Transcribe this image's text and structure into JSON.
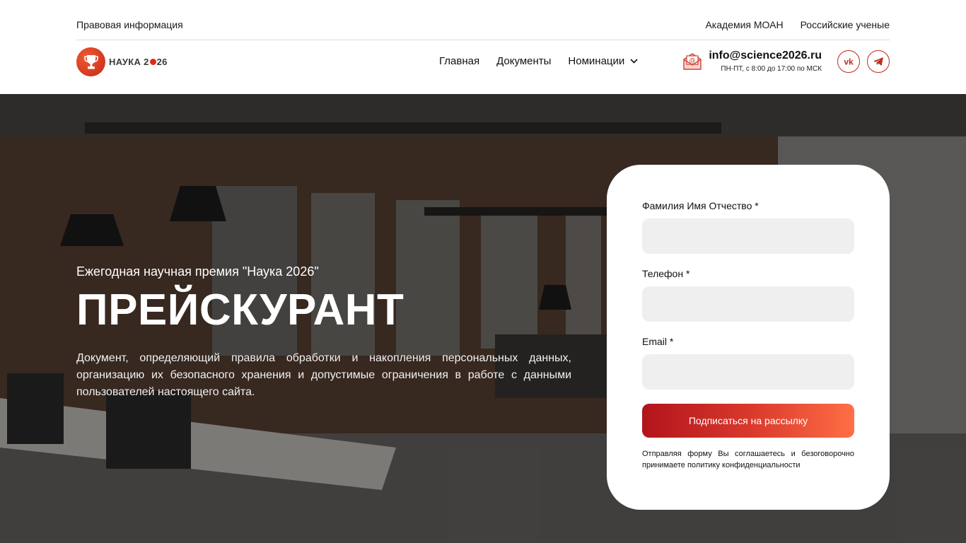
{
  "topbar": {
    "legal": "Правовая информация",
    "links": [
      "Академия МОАН",
      "Российские ученые"
    ]
  },
  "header": {
    "logo": {
      "prefix": "НАУКА 2",
      "suffix": "26"
    },
    "nav": [
      "Главная",
      "Документы",
      "Номинации"
    ],
    "contact": {
      "email": "info@science2026.ru",
      "hours": "ПН-ПТ, с 8:00 до 17:00 по МСК"
    },
    "socials": [
      "vk-icon",
      "telegram-icon"
    ]
  },
  "hero": {
    "subtitle": "Ежегодная научная премия \"Наука 2026\"",
    "title": "ПРЕЙСКУРАНТ",
    "description": "Документ, определяющий правила обработки и накопления персональных данных, организацию их безопасного хранения и допустимые ограничения в работе с данными пользователей настоящего сайта."
  },
  "form": {
    "fields": [
      {
        "label": "Фамилия Имя Отчество *",
        "value": "",
        "placeholder": ""
      },
      {
        "label": "Телефон *",
        "value": "",
        "placeholder": ""
      },
      {
        "label": "Email *",
        "value": "",
        "placeholder": ""
      }
    ],
    "submit": "Подписаться на рассылку",
    "note": "Отправляя форму Вы соглашаетесь и безоговорочно принимаете политику конфиденциальности"
  },
  "colors": {
    "accent": "#c0291e",
    "gradient_start": "#b3141b",
    "gradient_end": "#ff6e45"
  }
}
